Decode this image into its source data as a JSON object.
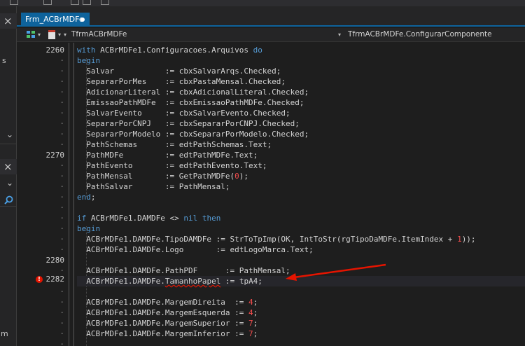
{
  "colors": {
    "background": "#1e1e1e",
    "keyword": "#569cd6",
    "number": "#f14c4c",
    "text": "#d4d4d4",
    "tab_active": "#0e639c",
    "breakpoint": "#e51400",
    "annotation_arrow": "#e51400"
  },
  "left_dock": {
    "close_glyph_1": "×",
    "fragment_s": "s",
    "chevron_1": "⌄",
    "close_glyph_2": "×",
    "chevron_2": "⌄",
    "search_icon": "search-icon",
    "fragment_m": "m"
  },
  "tab": {
    "label": "Frm_ACBrMDFe",
    "modified_marker": "●"
  },
  "navbar": {
    "class_label": "TfrmACBrMDFe",
    "method_label": "TfrmACBrMDFe.ConfigurarComponente",
    "caret": "▾"
  },
  "gutter": {
    "line_2260": "2260",
    "line_2270": "2270",
    "line_2280": "2280",
    "line_2282": "2282",
    "dot": "·",
    "breakpoint_glyph": "!"
  },
  "code": {
    "l01": "with ACBrMDFe1.Configuracoes.Arquivos do",
    "l02": "begin",
    "l03": "  Salvar           := cbxSalvarArqs.Checked;",
    "l04": "  SepararPorMes    := cbxPastaMensal.Checked;",
    "l05": "  AdicionarLiteral := cbxAdicionalLiteral.Checked;",
    "l06": "  EmissaoPathMDFe  := cbxEmissaoPathMDFe.Checked;",
    "l07": "  SalvarEvento     := cbxSalvarEvento.Checked;",
    "l08": "  SepararPorCNPJ   := cbxSepararPorCNPJ.Checked;",
    "l09": "  SepararPorModelo := cbxSepararPorModelo.Checked;",
    "l10": "  PathSchemas      := edtPathSchemas.Text;",
    "l11": "  PathMDFe         := edtPathMDFe.Text;",
    "l12": "  PathEvento       := edtPathEvento.Text;",
    "l13": "  PathMensal       := GetPathMDFe(",
    "l13_num": "0",
    "l13_tail": ");",
    "l14": "  PathSalvar       := PathMensal;",
    "l15": "end;",
    "l17": "if ACBrMDFe1.DAMDFe <> nil then",
    "l18": "begin",
    "l19": "  ACBrMDFe1.DAMDFe.TipoDAMDFe := StrToTpImp(OK, IntToStr(rgTipoDaMDFe.ItemIndex + ",
    "l19_num": "1",
    "l19_tail": "));",
    "l20": "  ACBrMDFe1.DAMDFe.Logo       := edtLogoMarca.Text;",
    "l22": "  ACBrMDFe1.DAMDFe.PathPDF      := PathMensal;",
    "l23_a": "  ACBrMDFe1.DAMDFe.",
    "l23_b": "TamanhoPapel",
    "l23_c": " := tpA4;",
    "l25": "  ACBrMDFe1.DAMDFe.MargemDireita  := ",
    "l25_num": "4",
    "l26": "  ACBrMDFe1.DAMDFe.MargemEsquerda := ",
    "l26_num": "4",
    "l27": "  ACBrMDFe1.DAMDFe.MargemSuperior := ",
    "l27_num": "7",
    "l28": "  ACBrMDFe1.DAMDFe.MargemInferior := ",
    "l28_num": "7",
    "semicolon": ";"
  }
}
